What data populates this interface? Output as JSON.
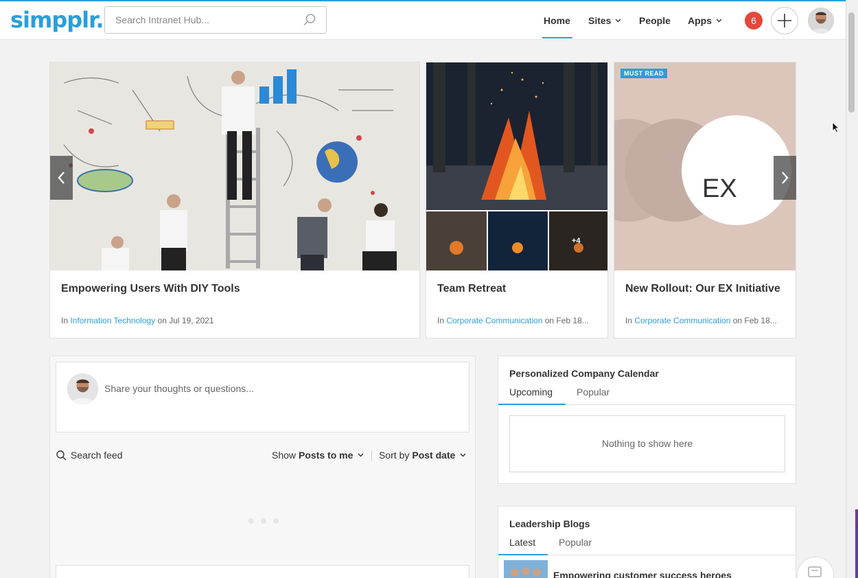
{
  "header": {
    "logo": "simpplr.",
    "search_placeholder": "Search Intranet Hub...",
    "nav": {
      "home": "Home",
      "sites": "Sites",
      "people": "People",
      "apps": "Apps"
    },
    "notification_count": "6"
  },
  "carousel": {
    "cards": [
      {
        "title": "Empowering Users With DIY Tools",
        "prefix": "In ",
        "site": "Information Technology",
        "date": " on Jul 19, 2021"
      },
      {
        "title": "Team Retreat",
        "prefix": "In ",
        "site": "Corporate Communication",
        "date": " on Feb 18...",
        "extra_photos": "+4"
      },
      {
        "title": "New Rollout: Our EX Initiative",
        "prefix": "In ",
        "site": "Corporate Communication",
        "date": " on Feb 18...",
        "badge": "MUST READ",
        "image_text": "EX"
      }
    ]
  },
  "feed": {
    "composer_placeholder": "Share your thoughts or questions...",
    "search_label": "Search feed",
    "show_label": "Show",
    "show_value": "Posts to me",
    "sort_label": "Sort by",
    "sort_value": "Post date"
  },
  "calendar_widget": {
    "title": "Personalized Company Calendar",
    "tabs": [
      "Upcoming",
      "Popular"
    ],
    "empty_text": "Nothing to show here"
  },
  "blogs_widget": {
    "title": "Leadership Blogs",
    "tabs": [
      "Latest",
      "Popular"
    ],
    "first_item": "Empowering customer success heroes"
  },
  "colors": {
    "accent": "#2a9fd8",
    "badge": "#e4473c"
  }
}
